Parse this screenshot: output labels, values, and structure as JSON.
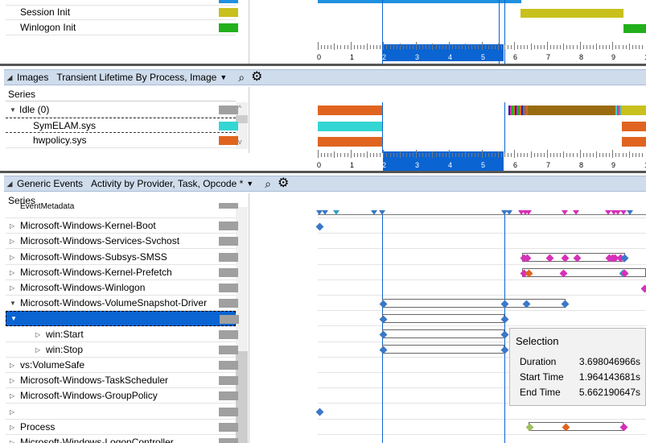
{
  "top_pane": {
    "rows": [
      {
        "label": "Session Init",
        "color": "#c8c01c"
      },
      {
        "label": "Winlogon Init",
        "color": "#22b01c"
      }
    ]
  },
  "axis": {
    "ticks": [
      "0",
      "1",
      "2",
      "3",
      "4",
      "5",
      "6",
      "7",
      "8",
      "9",
      "1"
    ]
  },
  "images_pane": {
    "name": "Images",
    "preset": "Transient Lifetime By Process, Image",
    "series_header": "Series",
    "rows": [
      {
        "label": "Idle (0)",
        "color": "#a0a0a0"
      },
      {
        "label": "SymELAM.sys",
        "color": "#33d6d3"
      },
      {
        "label": "hwpolicy.sys",
        "color": "#e06420"
      }
    ]
  },
  "generic_pane": {
    "name": "Generic Events",
    "preset": "Activity by Provider, Task, Opcode *",
    "series_header": "Series",
    "rows": [
      {
        "label": "EventMetadata",
        "color": "#a0a0a0"
      },
      {
        "label": "Microsoft-Windows-Kernel-Boot",
        "color": "#a0a0a0"
      },
      {
        "label": "Microsoft-Windows-Services-Svchost",
        "color": "#a0a0a0"
      },
      {
        "label": "Microsoft-Windows-Subsys-SMSS",
        "color": "#a0a0a0"
      },
      {
        "label": "Microsoft-Windows-Kernel-Prefetch",
        "color": "#a0a0a0"
      },
      {
        "label": "Microsoft-Windows-Winlogon",
        "color": "#a0a0a0"
      },
      {
        "label": "Microsoft-Windows-VolumeSnapshot-Driver",
        "color": "#a0a0a0"
      },
      {
        "label": "",
        "color": "#a0a0a0"
      },
      {
        "label": "win:Start",
        "color": "#a0a0a0"
      },
      {
        "label": "win:Stop",
        "color": "#a0a0a0"
      },
      {
        "label": "vs:VolumeSafe",
        "color": "#a0a0a0"
      },
      {
        "label": "Microsoft-Windows-TaskScheduler",
        "color": "#a0a0a0"
      },
      {
        "label": "Microsoft-Windows-GroupPolicy",
        "color": "#a0a0a0"
      },
      {
        "label": "",
        "color": "#a0a0a0"
      },
      {
        "label": "Process",
        "color": "#a0a0a0"
      },
      {
        "label": "Microsoft-Windows-LogonController",
        "color": "#a0a0a0"
      }
    ]
  },
  "selection_tooltip": {
    "title": "Selection",
    "duration_label": "Duration",
    "duration_value": "3.698046966s",
    "start_label": "Start Time",
    "start_value": "1.964143681s",
    "end_label": "End Time",
    "end_value": "5.662190647s"
  },
  "colors": {
    "selection_blue": "#0a64d2",
    "header_bg": "#cfdcec",
    "magenta": "#d630b8",
    "orange": "#e06420",
    "brown": "#9a6a10",
    "blue_diamond": "#3a78c7"
  }
}
